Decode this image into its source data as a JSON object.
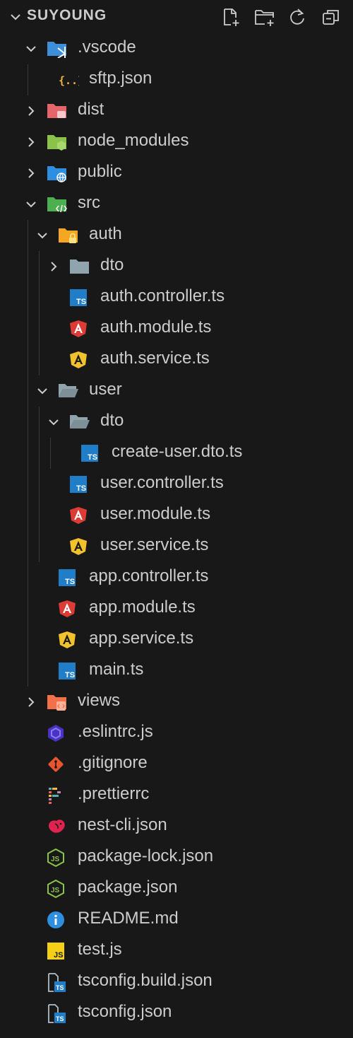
{
  "explorer": {
    "title": "SUYOUNG",
    "actions": [
      {
        "name": "new-file-icon"
      },
      {
        "name": "new-folder-icon"
      },
      {
        "name": "refresh-icon"
      },
      {
        "name": "collapse-all-icon"
      }
    ]
  },
  "tree": [
    {
      "label": ".vscode",
      "depth": 0,
      "kind": "folder",
      "expanded": true,
      "icon": "vscode-folder-icon",
      "color": "#3c8fd8"
    },
    {
      "label": "sftp.json",
      "depth": 1,
      "kind": "file",
      "icon": "json-braces-icon",
      "color": "#f1b53b"
    },
    {
      "label": "dist",
      "depth": 0,
      "kind": "folder",
      "expanded": false,
      "icon": "dist-folder-icon",
      "color": "#e4666b"
    },
    {
      "label": "node_modules",
      "depth": 0,
      "kind": "folder",
      "expanded": false,
      "icon": "node-folder-icon",
      "color": "#8bc34a"
    },
    {
      "label": "public",
      "depth": 0,
      "kind": "folder",
      "expanded": false,
      "icon": "public-folder-icon",
      "color": "#2e8fe0"
    },
    {
      "label": "src",
      "depth": 0,
      "kind": "folder",
      "expanded": true,
      "icon": "src-folder-icon",
      "color": "#4caf50"
    },
    {
      "label": "auth",
      "depth": 1,
      "kind": "folder",
      "expanded": true,
      "icon": "auth-folder-icon",
      "color": "#f5a623"
    },
    {
      "label": "dto",
      "depth": 2,
      "kind": "folder",
      "expanded": false,
      "icon": "folder-icon",
      "color": "#90a4ae"
    },
    {
      "label": "auth.controller.ts",
      "depth": 2,
      "kind": "file",
      "icon": "typescript-icon",
      "color": "#1f7ec7"
    },
    {
      "label": "auth.module.ts",
      "depth": 2,
      "kind": "file",
      "icon": "angular-module-icon",
      "color": "#dd3b35"
    },
    {
      "label": "auth.service.ts",
      "depth": 2,
      "kind": "file",
      "icon": "angular-service-icon",
      "color": "#f2c12e"
    },
    {
      "label": "user",
      "depth": 1,
      "kind": "folder",
      "expanded": true,
      "icon": "folder-open-icon",
      "color": "#90a4ae"
    },
    {
      "label": "dto",
      "depth": 2,
      "kind": "folder",
      "expanded": true,
      "icon": "folder-open-icon",
      "color": "#90a4ae"
    },
    {
      "label": "create-user.dto.ts",
      "depth": 3,
      "kind": "file",
      "icon": "typescript-icon",
      "color": "#1f7ec7"
    },
    {
      "label": "user.controller.ts",
      "depth": 2,
      "kind": "file",
      "icon": "typescript-icon",
      "color": "#1f7ec7"
    },
    {
      "label": "user.module.ts",
      "depth": 2,
      "kind": "file",
      "icon": "angular-module-icon",
      "color": "#dd3b35"
    },
    {
      "label": "user.service.ts",
      "depth": 2,
      "kind": "file",
      "icon": "angular-service-icon",
      "color": "#f2c12e"
    },
    {
      "label": "app.controller.ts",
      "depth": 1,
      "kind": "file",
      "icon": "typescript-icon",
      "color": "#1f7ec7"
    },
    {
      "label": "app.module.ts",
      "depth": 1,
      "kind": "file",
      "icon": "angular-module-icon",
      "color": "#dd3b35"
    },
    {
      "label": "app.service.ts",
      "depth": 1,
      "kind": "file",
      "icon": "angular-service-icon",
      "color": "#f2c12e"
    },
    {
      "label": "main.ts",
      "depth": 1,
      "kind": "file",
      "icon": "typescript-icon",
      "color": "#1f7ec7"
    },
    {
      "label": "views",
      "depth": 0,
      "kind": "folder",
      "expanded": false,
      "icon": "views-folder-icon",
      "color": "#f2704a"
    },
    {
      "label": ".eslintrc.js",
      "depth": 0,
      "kind": "file",
      "icon": "eslint-icon",
      "color": "#4b32c3"
    },
    {
      "label": ".gitignore",
      "depth": 0,
      "kind": "file",
      "icon": "git-icon",
      "color": "#e8552f"
    },
    {
      "label": ".prettierrc",
      "depth": 0,
      "kind": "file",
      "icon": "prettier-icon",
      "color": "#c596c7"
    },
    {
      "label": "nest-cli.json",
      "depth": 0,
      "kind": "file",
      "icon": "nestjs-icon",
      "color": "#e0234e"
    },
    {
      "label": "package-lock.json",
      "depth": 0,
      "kind": "file",
      "icon": "nodejs-icon",
      "color": "#8bc34a"
    },
    {
      "label": "package.json",
      "depth": 0,
      "kind": "file",
      "icon": "nodejs-icon",
      "color": "#8bc34a"
    },
    {
      "label": "README.md",
      "depth": 0,
      "kind": "file",
      "icon": "info-icon",
      "color": "#2e8fe0"
    },
    {
      "label": "test.js",
      "depth": 0,
      "kind": "file",
      "icon": "javascript-icon",
      "color": "#f5d016"
    },
    {
      "label": "tsconfig.build.json",
      "depth": 0,
      "kind": "file",
      "icon": "tsconfig-icon",
      "color": "#1f7ec7"
    },
    {
      "label": "tsconfig.json",
      "depth": 0,
      "kind": "file",
      "icon": "tsconfig-icon",
      "color": "#1f7ec7"
    }
  ]
}
